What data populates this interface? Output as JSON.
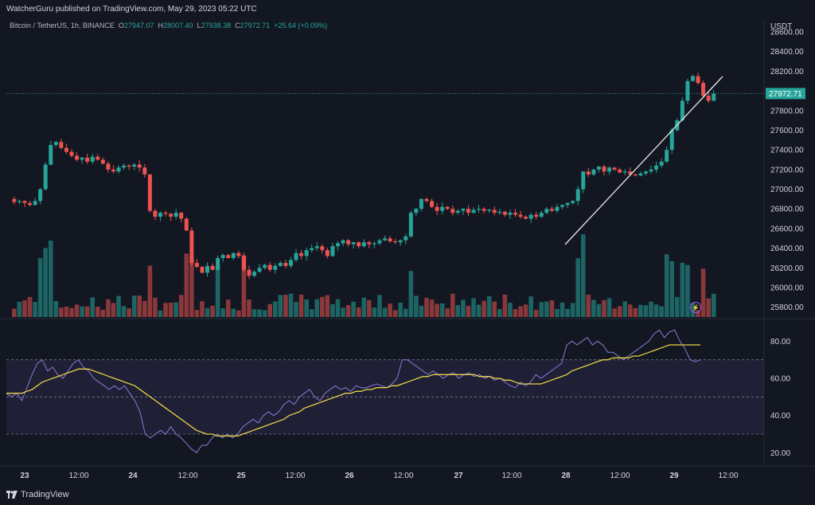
{
  "publish_line": "WatcherGuru published on TradingView.com, May 29, 2023 05:22 UTC",
  "symbol_line": {
    "name": "Bitcoin / TetherUS, 1h, BINANCE",
    "o_label": "O",
    "o_value": "27947.07",
    "h_label": "H",
    "h_value": "28007.40",
    "l_label": "L",
    "l_value": "27938.38",
    "c_label": "C",
    "c_value": "27972.71",
    "change": "+25.64 (+0.09%)"
  },
  "footer": {
    "brand": "TradingView"
  },
  "colors": {
    "up": "#26a69a",
    "down": "#ef5350",
    "rsi": "#8b7bd8",
    "rsi_ma": "#e6d34a",
    "background": "#131722",
    "grid": "#1f2330"
  },
  "icons": {
    "flash": "lightning-icon",
    "logo": "tradingview-logo-icon"
  },
  "chart_data": [
    {
      "type": "candlestick",
      "currency": "USDT",
      "y_ticks": [
        "25800.00",
        "26000.00",
        "26200.00",
        "26400.00",
        "26600.00",
        "26800.00",
        "27000.00",
        "27200.00",
        "27400.00",
        "27600.00",
        "27800.00",
        "28200.00",
        "28400.00",
        "28600.00"
      ],
      "ylim": [
        25700,
        28600
      ],
      "last_price": "27972.71",
      "x_ticks": [
        "23",
        "12:00",
        "24",
        "12:00",
        "25",
        "12:00",
        "26",
        "12:00",
        "27",
        "12:00",
        "28",
        "12:00",
        "29",
        "12:00"
      ],
      "close_path": [
        26900,
        26870,
        26880,
        26860,
        26840,
        26880,
        27000,
        27250,
        27450,
        27480,
        27420,
        27380,
        27340,
        27300,
        27320,
        27280,
        27330,
        27300,
        27260,
        27200,
        27180,
        27220,
        27240,
        27230,
        27250,
        27220,
        27150,
        26780,
        26720,
        26760,
        26750,
        26720,
        26760,
        26700,
        26580,
        26250,
        26210,
        26150,
        26220,
        26180,
        26300,
        26330,
        26300,
        26350,
        26320,
        26180,
        26120,
        26160,
        26200,
        26230,
        26180,
        26220,
        26250,
        26220,
        26280,
        26350,
        26320,
        26380,
        26400,
        26420,
        26380,
        26320,
        26420,
        26450,
        26480,
        26440,
        26460,
        26420,
        26460,
        26440,
        26450,
        26480,
        26500,
        26470,
        26460,
        26480,
        26520,
        26760,
        26800,
        26900,
        26880,
        26820,
        26780,
        26820,
        26800,
        26760,
        26780,
        26800,
        26760,
        26790,
        26800,
        26780,
        26790,
        26760,
        26770,
        26740,
        26760,
        26740,
        26720,
        26700,
        26740,
        26720,
        26760,
        26800,
        26780,
        26820,
        26840,
        26860,
        26880,
        27000,
        27180,
        27150,
        27200,
        27230,
        27180,
        27220,
        27200,
        27170,
        27180,
        27150,
        27140,
        27160,
        27180,
        27200,
        27240,
        27280,
        27400,
        27600,
        27700,
        27900,
        28100,
        28150,
        28080,
        27950,
        27900,
        27972
      ],
      "volume_bars": 140,
      "annotation": "trendline drawn from ~28 09:00 to ~29 02:00"
    },
    {
      "type": "line",
      "name": "RSI",
      "y_ticks": [
        "20.00",
        "40.00",
        "60.00",
        "80.00"
      ],
      "ylim": [
        15,
        90
      ],
      "bands": [
        30,
        50,
        70
      ],
      "rsi": [
        52,
        50,
        52,
        48,
        55,
        62,
        68,
        70,
        64,
        66,
        62,
        60,
        64,
        68,
        70,
        66,
        64,
        60,
        58,
        56,
        54,
        56,
        54,
        56,
        52,
        48,
        42,
        30,
        28,
        30,
        32,
        30,
        34,
        30,
        28,
        25,
        22,
        20,
        24,
        24,
        28,
        30,
        28,
        30,
        28,
        30,
        34,
        36,
        38,
        36,
        40,
        42,
        40,
        42,
        46,
        48,
        46,
        50,
        52,
        54,
        50,
        48,
        52,
        54,
        56,
        54,
        55,
        53,
        56,
        55,
        55,
        56,
        57,
        56,
        55,
        57,
        60,
        70,
        70,
        68,
        66,
        64,
        62,
        64,
        62,
        60,
        62,
        63,
        60,
        62,
        63,
        61,
        62,
        60,
        61,
        59,
        60,
        58,
        56,
        55,
        58,
        56,
        58,
        62,
        60,
        62,
        64,
        66,
        68,
        78,
        80,
        78,
        80,
        82,
        78,
        80,
        78,
        74,
        74,
        72,
        70,
        72,
        74,
        76,
        78,
        80,
        84,
        86,
        82,
        85,
        86,
        80,
        76,
        70,
        69,
        70
      ],
      "rsi_ma": [
        52,
        52,
        52,
        52,
        53,
        54,
        56,
        58,
        59,
        60,
        61,
        62,
        63,
        64,
        65,
        65,
        65,
        64,
        63,
        62,
        61,
        60,
        59,
        58,
        57,
        56,
        54,
        52,
        50,
        48,
        46,
        44,
        42,
        40,
        38,
        36,
        34,
        32,
        31,
        30,
        30,
        29,
        29,
        29,
        29,
        29,
        30,
        31,
        32,
        33,
        34,
        35,
        36,
        37,
        38,
        40,
        41,
        42,
        44,
        45,
        46,
        47,
        48,
        49,
        50,
        51,
        52,
        52,
        53,
        53,
        54,
        54,
        55,
        55,
        55,
        56,
        56,
        57,
        58,
        59,
        60,
        61,
        61,
        62,
        62,
        62,
        62,
        62,
        62,
        62,
        62,
        62,
        61,
        61,
        61,
        60,
        60,
        59,
        59,
        58,
        57,
        57,
        57,
        57,
        57,
        58,
        59,
        60,
        61,
        62,
        64,
        65,
        66,
        67,
        68,
        69,
        70,
        70,
        71,
        71,
        71,
        71,
        72,
        72,
        73,
        74,
        75,
        76,
        77,
        78,
        78,
        78,
        78,
        78,
        78,
        78
      ]
    }
  ]
}
